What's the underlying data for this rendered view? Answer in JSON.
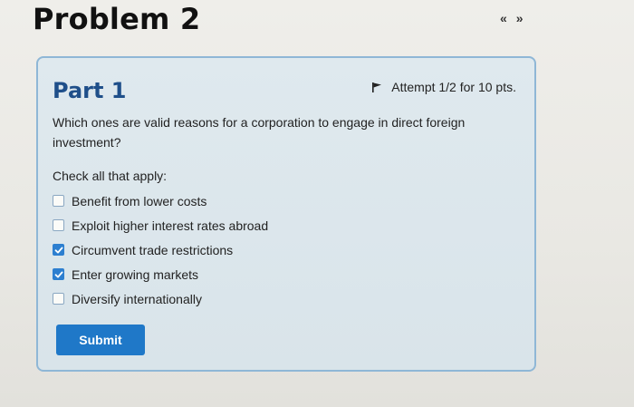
{
  "header": {
    "title": "Problem 2",
    "nav_prev_icon": "double-chevron-left-icon",
    "nav_next_icon": "double-chevron-right-icon",
    "nav_prev_glyph": "«",
    "nav_next_glyph": "»"
  },
  "part": {
    "title": "Part 1",
    "attempt_text": "Attempt 1/2 for 10 pts.",
    "question": "Which ones are valid reasons for a corporation to engage in direct foreign investment?",
    "instruction": "Check all that apply:",
    "options": [
      {
        "label": "Benefit from lower costs",
        "checked": false
      },
      {
        "label": "Exploit higher interest rates abroad",
        "checked": false
      },
      {
        "label": "Circumvent trade restrictions",
        "checked": true
      },
      {
        "label": "Enter growing markets",
        "checked": true
      },
      {
        "label": "Diversify internationally",
        "checked": false
      }
    ],
    "submit_label": "Submit"
  },
  "colors": {
    "accent": "#1f78c8",
    "part_title": "#1f4f8a",
    "card_border": "#8fb7d6"
  }
}
